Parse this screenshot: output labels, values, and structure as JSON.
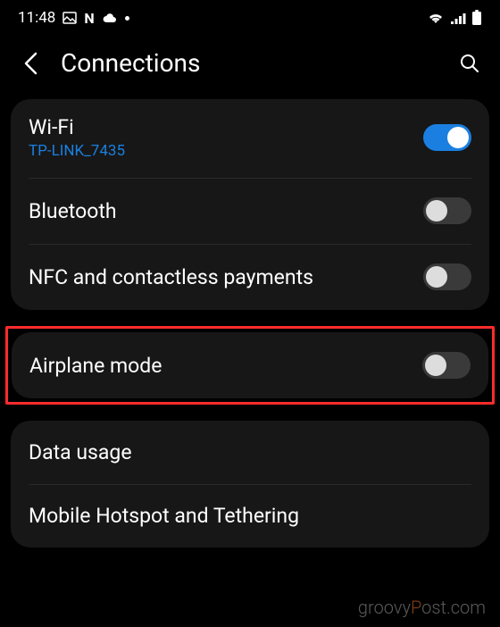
{
  "statusbar": {
    "time": "11:48",
    "icons_left": [
      "image-icon",
      "n-icon",
      "cloud-icon",
      "dot-icon"
    ],
    "icons_right": [
      "wifi-icon",
      "signal-icon",
      "battery-icon"
    ]
  },
  "header": {
    "title": "Connections"
  },
  "group1": {
    "wifi": {
      "title": "Wi-Fi",
      "sub": "TP-LINK_7435",
      "on": true
    },
    "bluetooth": {
      "title": "Bluetooth",
      "on": false
    },
    "nfc": {
      "title": "NFC and contactless payments",
      "on": false
    }
  },
  "group2": {
    "airplane": {
      "title": "Airplane mode",
      "on": false
    }
  },
  "group3": {
    "data": {
      "title": "Data usage"
    },
    "hotspot": {
      "title": "Mobile Hotspot and Tethering"
    }
  },
  "watermark": {
    "pre": "groovy",
    "accent": "P",
    "post": "ost.com"
  }
}
